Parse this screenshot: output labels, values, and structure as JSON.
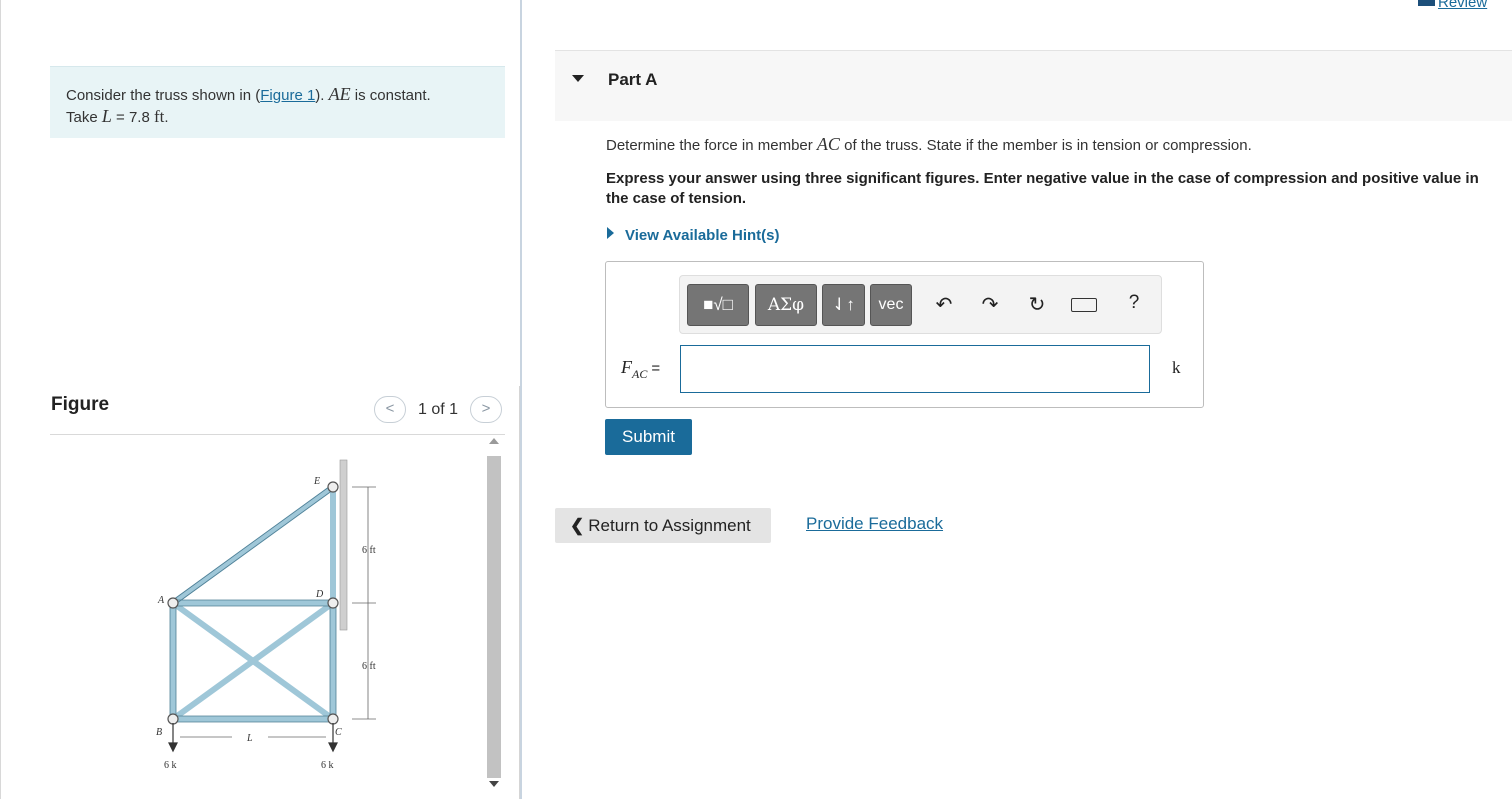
{
  "header": {
    "review_label": "Review"
  },
  "problem": {
    "intro": "Consider the truss shown in (",
    "figure_link": "Figure 1",
    "after_link": "). ",
    "ae_symbol": "AE",
    "ae_text": " is constant.",
    "take_text": "Take ",
    "l_symbol": "L",
    "l_value": " = 7.8 ",
    "l_unit": "ft",
    "end": "."
  },
  "figure": {
    "heading": "Figure",
    "counter": "1 of 1",
    "prev_glyph": "<",
    "next_glyph": ">",
    "labels": {
      "node_e": "E",
      "node_d": "D",
      "node_a": "A",
      "node_b": "B",
      "node_c": "C",
      "dim_upper": "6 ft",
      "dim_lower": "6 ft",
      "span": "L",
      "load_b": "6 k",
      "load_c": "6 k"
    }
  },
  "part": {
    "title": "Part A",
    "question_pre": "Determine the force in member ",
    "question_member": "AC",
    "question_post": " of the truss. State if the member is in tension or compression.",
    "instructions": "Express your answer using three significant figures. Enter negative value in the case of compression and positive value in the case of tension.",
    "hint_label": "View Available Hint(s)"
  },
  "toolbar": {
    "templates_label": "■√□",
    "symbols_label": "ΑΣφ",
    "arrows_label": "⇃↑",
    "vec_label": "vec",
    "undo_glyph": "↶",
    "redo_glyph": "↷",
    "reset_glyph": "↻",
    "help_glyph": "?"
  },
  "answer": {
    "var_main": "F",
    "var_sub": "AC",
    "equals": "=",
    "value": "",
    "unit": "k"
  },
  "actions": {
    "submit_label": "Submit",
    "return_glyph": "❮",
    "return_label": "Return to Assignment",
    "feedback_label": "Provide Feedback"
  }
}
